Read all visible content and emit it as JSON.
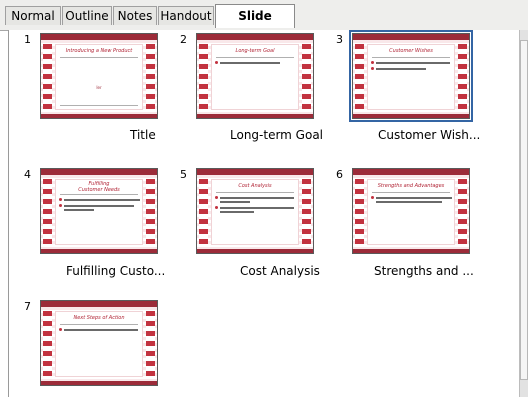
{
  "tabs": [
    {
      "label": "Normal"
    },
    {
      "label": "Outline"
    },
    {
      "label": "Notes"
    },
    {
      "label": "Handout"
    },
    {
      "label": "Slide Sorter"
    }
  ],
  "slides": [
    {
      "number": "1",
      "caption": "Title",
      "thumb_title": "Introducing a New Product",
      "thumb_sub": "Ier"
    },
    {
      "number": "2",
      "caption": "Long-term Goal",
      "thumb_title": "Long-term Goal"
    },
    {
      "number": "3",
      "caption": "Customer Wish...",
      "thumb_title": "Customer Wishes"
    },
    {
      "number": "4",
      "caption": "Fulfilling Custo...",
      "thumb_title": "Fulfilling Customer Needs"
    },
    {
      "number": "5",
      "caption": "Cost Analysis",
      "thumb_title": "Cost Analysis"
    },
    {
      "number": "6",
      "caption": "Strengths and ...",
      "thumb_title": "Strengths and Advantages"
    },
    {
      "number": "7",
      "caption": "",
      "thumb_title": "Next Steps of Action"
    }
  ],
  "colors": {
    "accent": "#3465a4",
    "slide_red": "#c2323f",
    "slide_title": "#b02233"
  },
  "selected_slide": "3"
}
